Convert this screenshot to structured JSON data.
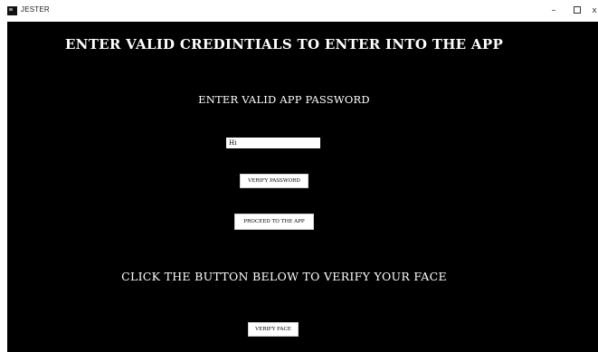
{
  "window": {
    "title": "JESTER",
    "controls": {
      "minimize": "–",
      "close": "x"
    }
  },
  "main": {
    "heading": "ENTER VALID CREDINTIALS TO ENTER INTO THE APP",
    "password_prompt": "ENTER VALID APP PASSWORD",
    "password_value": "Hi",
    "verify_password_label": "VERIFY PASSWORD",
    "proceed_label": "PROCEED TO THE APP",
    "face_prompt": "CLICK THE BUTTON BELOW TO VERIFY YOUR FACE",
    "verify_face_label": "VERIFY FACE"
  },
  "icons": {
    "app": "app-icon",
    "maximize": "maximize-icon"
  },
  "colors": {
    "background": "#000000",
    "text": "#ffffff",
    "button_bg": "#ffffff"
  }
}
